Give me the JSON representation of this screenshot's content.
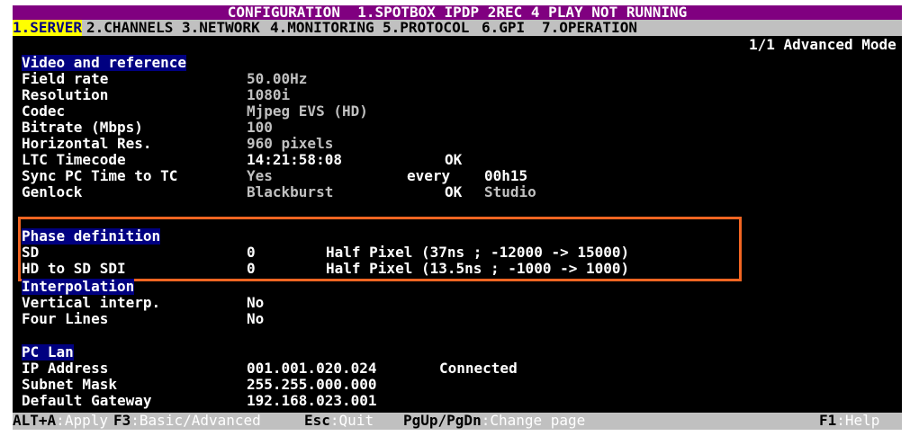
{
  "title": "CONFIGURATION  1.SPOTBOX IPDP 2REC 4 PLAY NOT RUNNING",
  "tabs": [
    {
      "label": "1.SERVER"
    },
    {
      "label": "2.CHANNELS"
    },
    {
      "label": "3.NETWORK"
    },
    {
      "label": "4.MONITORING"
    },
    {
      "label": "5.PROTOCOL"
    },
    {
      "label": "6.GPI"
    },
    {
      "label": "7.OPERATION"
    }
  ],
  "page_info": "1/1 Advanced Mode",
  "video": {
    "heading": "Video and reference",
    "field_rate": {
      "label": "Field rate",
      "value": "50.00Hz"
    },
    "resolution": {
      "label": "Resolution",
      "value": "1080i"
    },
    "codec": {
      "label": "Codec",
      "value": "Mjpeg EVS (HD)"
    },
    "bitrate": {
      "label": "Bitrate (Mbps)",
      "value": "100"
    },
    "horizontal_res": {
      "label": "Horizontal Res.",
      "value": "960 pixels"
    },
    "ltc": {
      "label": "LTC Timecode",
      "value": "14:21:58:08",
      "status": "OK"
    },
    "sync_pc": {
      "label": "Sync PC Time to TC",
      "value": "Yes",
      "every_label": "every",
      "every_value": "00h15"
    },
    "genlock": {
      "label": "Genlock",
      "value": "Blackburst",
      "status": "OK",
      "extra": "Studio"
    }
  },
  "phase": {
    "heading": "Phase definition",
    "sd": {
      "label": "SD",
      "value": "0",
      "desc": "Half Pixel (37ns ; -12000 -> 15000)"
    },
    "hd_sd": {
      "label": "HD to SD SDI",
      "value": "0",
      "desc": "Half Pixel (13.5ns ; -1000 -> 1000)"
    }
  },
  "interpolation": {
    "heading": "Interpolation",
    "vertical": {
      "label": "Vertical interp.",
      "value": "No"
    },
    "four_lines": {
      "label": "Four Lines",
      "value": "No"
    }
  },
  "pclan": {
    "heading": "PC Lan",
    "ip": {
      "label": "IP Address",
      "value": "001.001.020.024",
      "status": "Connected"
    },
    "mask": {
      "label": "Subnet Mask",
      "value": "255.255.000.000"
    },
    "gateway": {
      "label": "Default Gateway",
      "value": "192.168.023.001"
    }
  },
  "status_bar": {
    "apply_key": "ALT+A",
    "apply_label": "Apply",
    "mode_key": "F3",
    "mode_label": "Basic/Advanced",
    "quit_key": "Esc",
    "quit_label": "Quit",
    "page_key": "PgUp/PgDn",
    "page_label": "Change page",
    "help_key": "F1",
    "help_label": "Help",
    "separator": ":"
  },
  "colors": {
    "title_bg": "#800080",
    "menu_bg": "#c0c0c0",
    "active_tab_bg": "#ffff00",
    "section_bg": "#000080",
    "highlight_border": "#f26522"
  }
}
